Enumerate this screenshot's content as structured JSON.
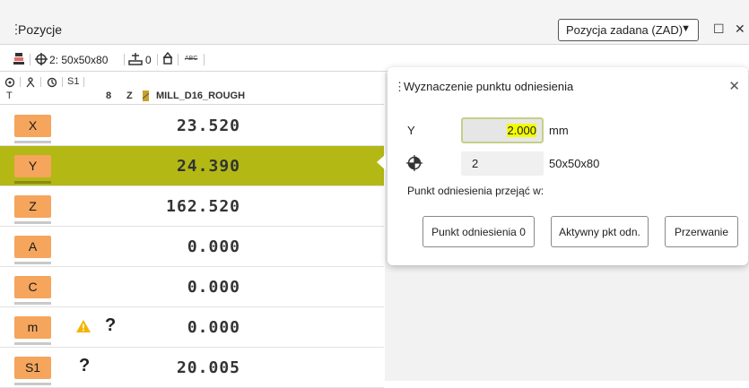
{
  "window": {
    "title": "Pozycje",
    "mode_dropdown": "Pozycja zadana (ZAD)"
  },
  "status_bar": {
    "workpiece": "2: 50x50x80",
    "preset": "0",
    "abc_label": "ABC"
  },
  "tool_info": {
    "row1_item": "S1",
    "tool_label": "T",
    "tool_number": "8",
    "tool_axis": "Z",
    "tool_name": "MILL_D16_ROUGH"
  },
  "axes": [
    {
      "label": "X",
      "value": "23.520",
      "active": false,
      "warning": false,
      "unknown": false
    },
    {
      "label": "Y",
      "value": "24.390",
      "active": true,
      "warning": false,
      "unknown": false
    },
    {
      "label": "Z",
      "value": "162.520",
      "active": false,
      "warning": false,
      "unknown": false
    },
    {
      "label": "A",
      "value": "0.000",
      "active": false,
      "warning": false,
      "unknown": false
    },
    {
      "label": "C",
      "value": "0.000",
      "active": false,
      "warning": false,
      "unknown": false
    },
    {
      "label": "m",
      "value": "0.000",
      "active": false,
      "warning": true,
      "unknown": true
    },
    {
      "label": "S1",
      "value": "20.005",
      "active": false,
      "warning": false,
      "unknown": true
    }
  ],
  "unknown_mark": "?",
  "popup": {
    "title": "Wyznaczenie punktu odniesienia",
    "axis_label": "Y",
    "axis_value": "2.000",
    "unit": "mm",
    "preset_number": "2",
    "preset_name": "50x50x80",
    "transfer_label": "Punkt odniesienia przejąć w:",
    "buttons": {
      "preset0": "Punkt odniesienia 0",
      "active": "Aktywny pkt odn.",
      "cancel": "Przerwanie"
    }
  },
  "colors": {
    "active_row": "#b3b815",
    "axis_button": "#f5a55c",
    "input_highlight": "#f2ff00"
  }
}
